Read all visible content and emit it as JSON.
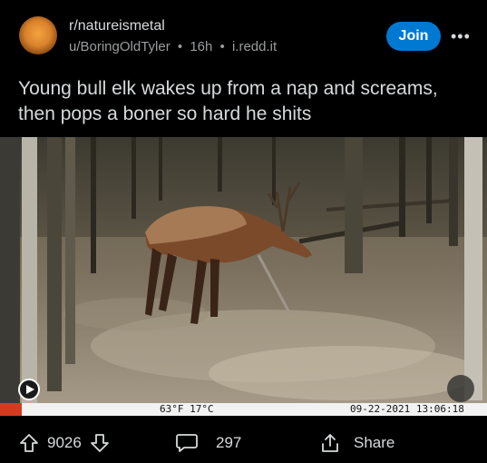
{
  "post": {
    "subreddit": "r/natureismetal",
    "author": "u/BoringOldTyler",
    "time": "16h",
    "domain": "i.redd.it",
    "separator": "•",
    "join_label": "Join",
    "more_label": "•••",
    "title": "Young bull elk wakes up from a nap and screams, then pops a boner so hard he shits"
  },
  "media": {
    "temperature": "63°F 17°C",
    "datetime": "09-22-2021  13:06:18"
  },
  "actions": {
    "score": "9026",
    "comments": "297",
    "share_label": "Share"
  },
  "colors": {
    "background": "#000000",
    "join_button": "#0079d3",
    "text": "#d7dadc",
    "meta_text": "#9a9c9e"
  },
  "icons": {
    "upvote": "upvote-arrow-icon",
    "downvote": "downvote-arrow-icon",
    "comment": "comment-bubble-icon",
    "share": "share-icon"
  }
}
